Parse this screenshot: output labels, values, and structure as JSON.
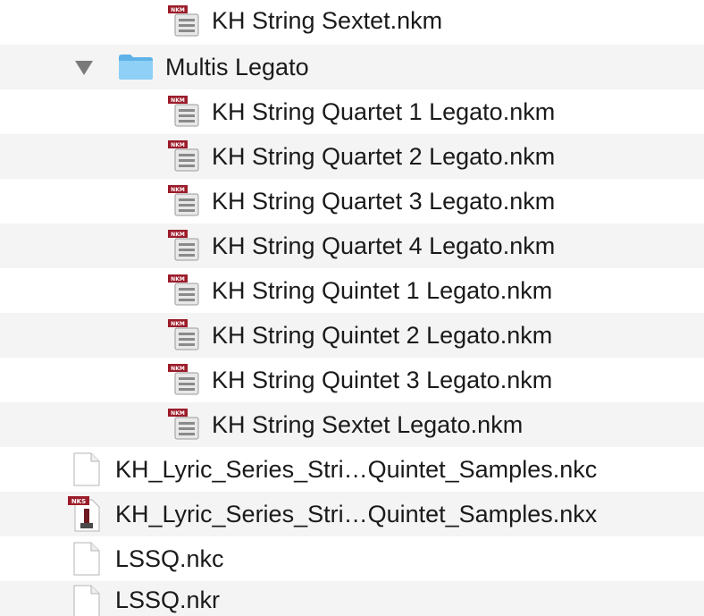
{
  "finder_list": {
    "rows": [
      {
        "type": "nkm",
        "label": "KH String Sextet.nkm",
        "icon": "nkm-file-icon"
      },
      {
        "type": "folder",
        "label": "Multis Legato",
        "icon": "folder-icon",
        "expanded": true
      },
      {
        "type": "nkm",
        "label": "KH String Quartet 1 Legato.nkm",
        "icon": "nkm-file-icon"
      },
      {
        "type": "nkm",
        "label": "KH String Quartet 2 Legato.nkm",
        "icon": "nkm-file-icon"
      },
      {
        "type": "nkm",
        "label": "KH String Quartet 3 Legato.nkm",
        "icon": "nkm-file-icon"
      },
      {
        "type": "nkm",
        "label": "KH String Quartet 4 Legato.nkm",
        "icon": "nkm-file-icon"
      },
      {
        "type": "nkm",
        "label": "KH String Quintet 1 Legato.nkm",
        "icon": "nkm-file-icon"
      },
      {
        "type": "nkm",
        "label": "KH String Quintet 2 Legato.nkm",
        "icon": "nkm-file-icon"
      },
      {
        "type": "nkm",
        "label": "KH String Quintet 3 Legato.nkm",
        "icon": "nkm-file-icon"
      },
      {
        "type": "nkm",
        "label": "KH String Sextet Legato.nkm",
        "icon": "nkm-file-icon"
      },
      {
        "type": "doc",
        "label": "KH_Lyric_Series_Stri…Quintet_Samples.nkc",
        "icon": "document-icon"
      },
      {
        "type": "nks",
        "label": "KH_Lyric_Series_Stri…Quintet_Samples.nkx",
        "icon": "nks-file-icon"
      },
      {
        "type": "doc",
        "label": "LSSQ.nkc",
        "icon": "document-icon"
      },
      {
        "type": "doc",
        "label": "LSSQ.nkr",
        "icon": "document-icon"
      }
    ],
    "icon_badges": {
      "nkm": "NKM",
      "nks": "NKS"
    },
    "colors": {
      "stripe": "#f4f4f4",
      "folder": "#6cc0f0",
      "badge_red": "#9c1c2a",
      "disclosure": "#7a7a7a"
    }
  }
}
